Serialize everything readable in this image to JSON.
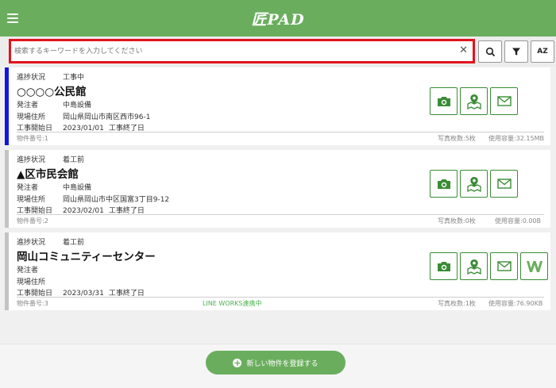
{
  "header": {
    "logo_text": "匠PAD"
  },
  "search": {
    "placeholder": "検索するキーワードを入力してください",
    "value": ""
  },
  "toolbar": {
    "sort_label": "AZ"
  },
  "labels": {
    "progress": "進捗状況",
    "client": "発注者",
    "site_address": "現場住所",
    "start_date": "工事開始日",
    "end_date": "工事終了日",
    "property_no_prefix": "物件番号:",
    "photo_count_prefix": "写真枚数:",
    "usage_prefix": "使用容量:"
  },
  "properties": [
    {
      "status": "工事中",
      "name": "○○○○公民館",
      "client": "中島設備",
      "address": "岡山県岡山市南区西市96-1",
      "start_date": "2023/01/01",
      "property_no": "1",
      "photo_count": "5枚",
      "usage": "32.15MB",
      "line_works": ""
    },
    {
      "status": "着工前",
      "name": "▲区市民会館",
      "client": "中島設備",
      "address": "岡山県岡山市中区国富3丁目9-12",
      "start_date": "2023/02/01",
      "property_no": "2",
      "photo_count": "0枚",
      "usage": "0.00B",
      "line_works": ""
    },
    {
      "status": "着工前",
      "name": "岡山コミュニティーセンター",
      "client": "",
      "address": "",
      "start_date": "2023/03/31",
      "property_no": "3",
      "photo_count": "1枚",
      "usage": "76.90KB",
      "line_works": "LINE WORKS連携中"
    }
  ],
  "bottom": {
    "register_label": "新しい物件を登録する"
  },
  "colors": {
    "header": "#6aae5d",
    "active_border": "#1414e0",
    "search_highlight": "#e0141e",
    "button_green": "#3a8c35"
  }
}
